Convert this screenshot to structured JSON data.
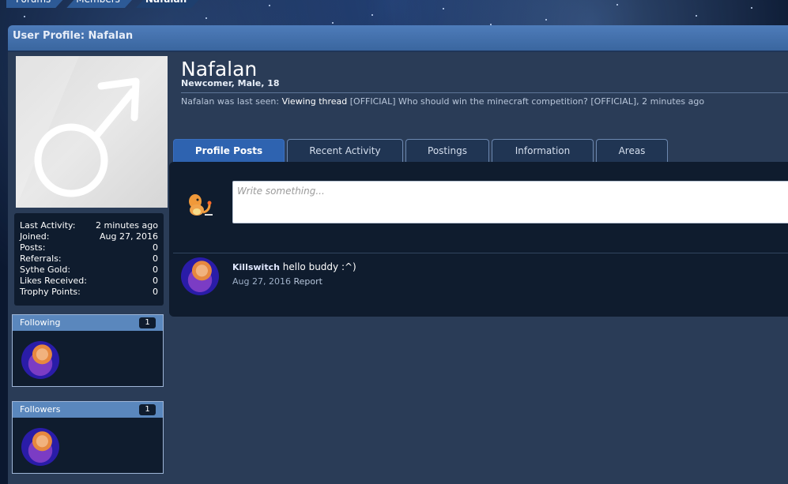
{
  "breadcrumb": [
    "Forums",
    "Members",
    "Nafalan"
  ],
  "panel": {
    "title": "User Profile: Nafalan"
  },
  "profile": {
    "username": "Nafalan",
    "user_title": "Newcomer, Male, 18",
    "last_seen_prefix": "Nafalan was last seen:",
    "last_seen_activity": "Viewing thread",
    "last_seen_thread": "[OFFICIAL] Who should win the minecraft competition? [OFFICIAL]",
    "last_seen_time": ", 2 minutes ago"
  },
  "stats": [
    {
      "label": "Last Activity:",
      "value": "2 minutes ago"
    },
    {
      "label": "Joined:",
      "value": "Aug 27, 2016"
    },
    {
      "label": "Posts:",
      "value": "0"
    },
    {
      "label": "Referrals:",
      "value": "0"
    },
    {
      "label": "Sythe Gold:",
      "value": "0"
    },
    {
      "label": "Likes Received:",
      "value": "0"
    },
    {
      "label": "Trophy Points:",
      "value": "0"
    }
  ],
  "following": {
    "title": "Following",
    "count": "1"
  },
  "followers": {
    "title": "Followers",
    "count": "1"
  },
  "tabs": [
    "Profile Posts",
    "Recent Activity",
    "Postings",
    "Information",
    "Areas"
  ],
  "status_box": {
    "placeholder": "Write something..."
  },
  "post": {
    "author": "Killswitch",
    "message": "hello buddy :^)",
    "date": "Aug 27, 2016",
    "report_label": "Report"
  },
  "colors": {
    "accent": "#2e63b0",
    "panel": "#2a3c57",
    "dark": "#0f1c2e"
  }
}
